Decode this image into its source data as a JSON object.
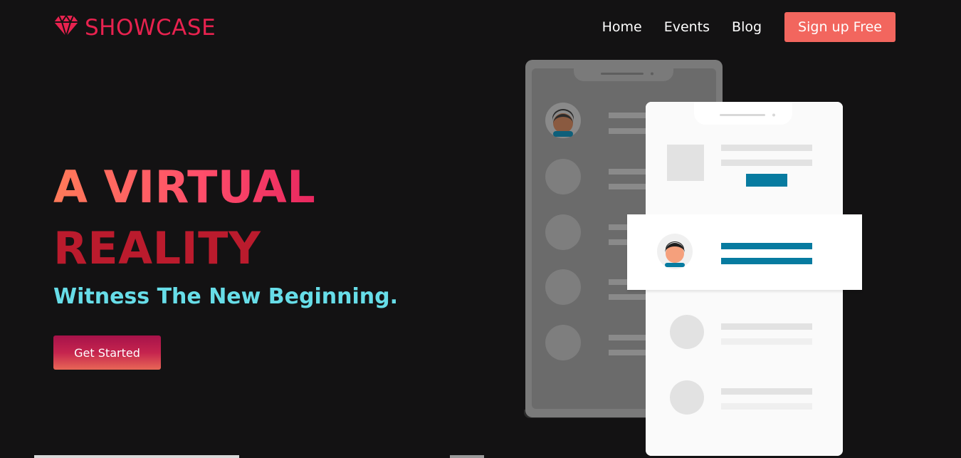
{
  "header": {
    "logo_icon": "diamond-icon",
    "logo_text": "SHOWCASE",
    "nav": [
      {
        "label": "Home"
      },
      {
        "label": "Events"
      },
      {
        "label": "Blog"
      }
    ],
    "signup_label": "Sign up Free"
  },
  "hero": {
    "title_line1": "A VIRTUAL",
    "title_line2": "REALITY",
    "tagline": "Witness The New Beginning.",
    "cta_label": "Get Started"
  },
  "colors": {
    "brand": "#e8224f",
    "signup": "#f2665e",
    "tagline": "#67dde8",
    "accent_bar": "#077ba0"
  }
}
